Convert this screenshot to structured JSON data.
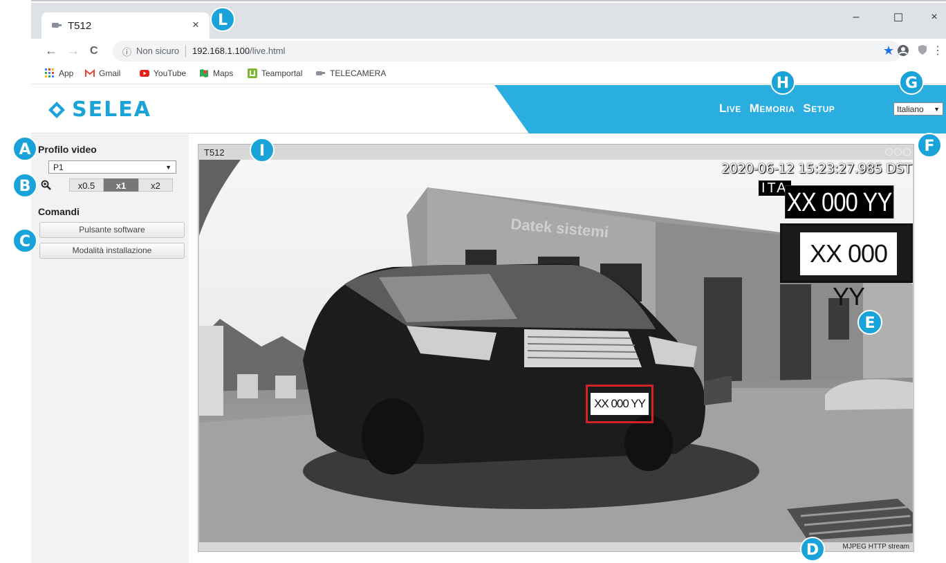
{
  "browser": {
    "tab_title": "T512",
    "tab_close": "×",
    "window_controls": {
      "minimize": "–",
      "maximize": "☐",
      "close": "×"
    },
    "nav": {
      "back": "←",
      "forward": "→",
      "reload": "C"
    },
    "omnibox": {
      "info": "ⓘ",
      "security": "Non sicuro",
      "host": "192.168.1.100",
      "path": "/live.html"
    },
    "bookmarks": [
      {
        "label": "App",
        "icon": "apps-grid-icon"
      },
      {
        "label": "Gmail",
        "icon": "gmail-icon"
      },
      {
        "label": "YouTube",
        "icon": "youtube-icon"
      },
      {
        "label": "Maps",
        "icon": "maps-icon"
      },
      {
        "label": "Teamportal",
        "icon": "teamportal-icon"
      },
      {
        "label": "TELECAMERA",
        "icon": "camera-icon"
      }
    ]
  },
  "header": {
    "logo": "SELEA",
    "menu": [
      "Live",
      "Memoria",
      "Setup"
    ],
    "language": "Italiano",
    "accent_color": "#2aaee0"
  },
  "sidebar": {
    "profile_title": "Profilo video",
    "profile_value": "P1",
    "zoom_options": [
      "x0.5",
      "x1",
      "x2"
    ],
    "zoom_selected": "x1",
    "commands_title": "Comandi",
    "commands": [
      "Pulsante software",
      "Modalità installazione"
    ]
  },
  "video": {
    "title": "T512",
    "timestamp": "2020-06-12 15:23:27.985 DST",
    "country": "ITA",
    "plate_read": "XX 000 YY",
    "plate_crop": "XX 000 YY",
    "plate_on_car": "XX 000 YY",
    "building_sign": "Datek sistemi",
    "stream_type": "MJPEG HTTP stream"
  },
  "markers": [
    "A",
    "B",
    "C",
    "D",
    "E",
    "F",
    "G",
    "H",
    "I",
    "L"
  ]
}
